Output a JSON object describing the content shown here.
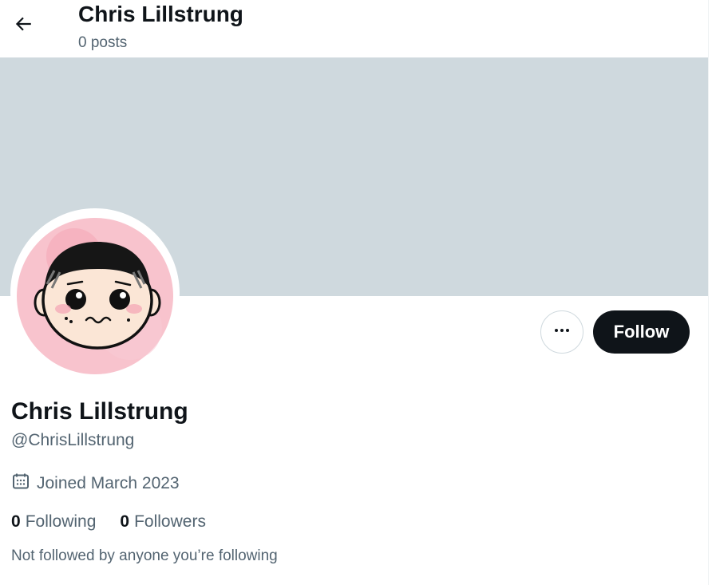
{
  "header": {
    "title": "Chris Lillstrung",
    "posts_count": "0 posts",
    "back_icon": "arrow-left-icon"
  },
  "colors": {
    "banner": "#cfd9de",
    "follow_bg": "#0f1419",
    "secondary_text": "#536471",
    "avatar_blush": "#f7b8c4"
  },
  "profile": {
    "display_name": "Chris Lillstrung",
    "handle": "@ChrisLillstrung",
    "joined": "Joined March 2023",
    "following_count": "0",
    "following_label": "Following",
    "followers_count": "0",
    "followers_label": "Followers",
    "not_followed_text": "Not followed by anyone you’re following"
  },
  "actions": {
    "follow_label": "Follow",
    "more_icon": "more-horizontal-icon"
  }
}
